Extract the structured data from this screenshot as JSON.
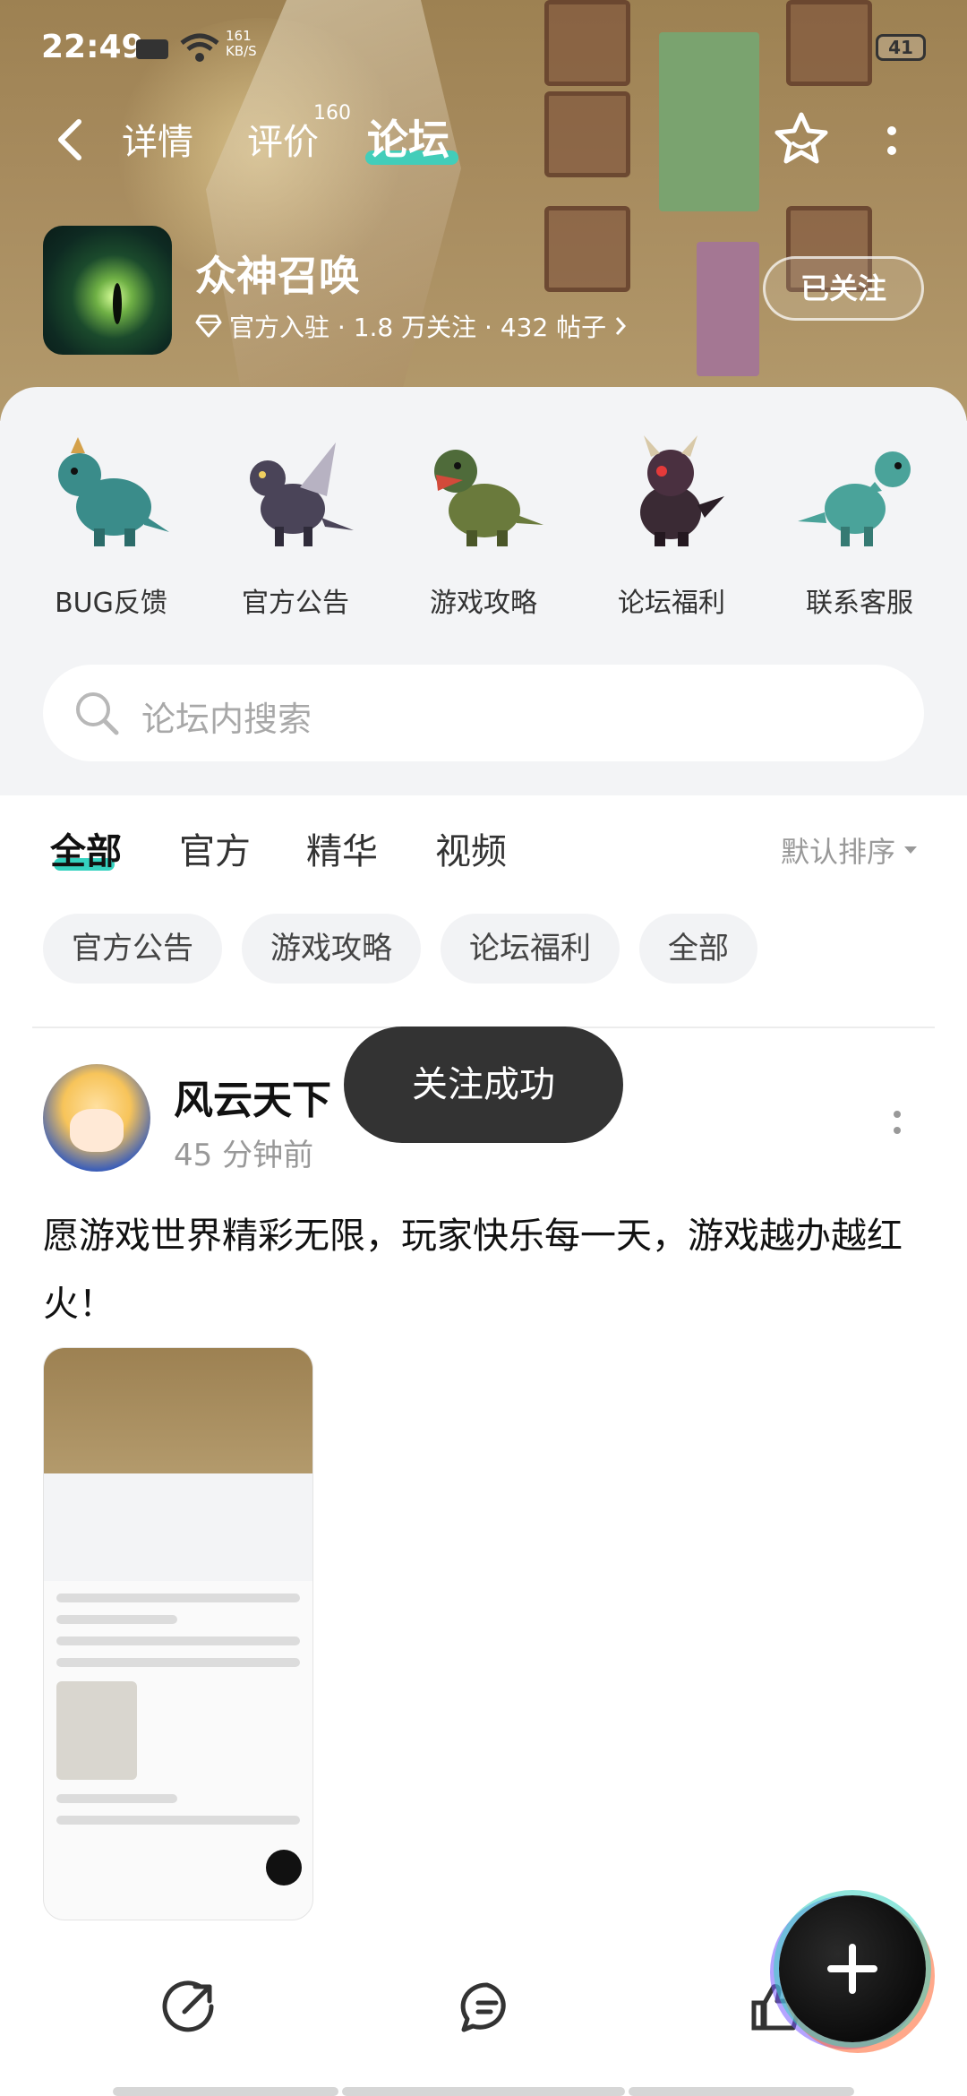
{
  "status_bar": {
    "time": "22:49",
    "speed_value": "161",
    "speed_unit": "KB/S",
    "battery": "41"
  },
  "nav": {
    "tabs": [
      {
        "label": "详情",
        "active": false
      },
      {
        "label": "评价",
        "active": false,
        "badge": "160"
      },
      {
        "label": "论坛",
        "active": true
      }
    ]
  },
  "app": {
    "name": "众神召唤",
    "meta": "官方入驻 · 1.8 万关注 · 432 帖子",
    "follow_label": "已关注"
  },
  "categories": [
    {
      "label": "BUG反馈",
      "color": "#3a8c8a"
    },
    {
      "label": "官方公告",
      "color": "#4a4458"
    },
    {
      "label": "游戏攻略",
      "color": "#6a7a3c"
    },
    {
      "label": "论坛福利",
      "color": "#3a2a34"
    },
    {
      "label": "联系客服",
      "color": "#4aa39a"
    }
  ],
  "search": {
    "placeholder": "论坛内搜索"
  },
  "filter_tabs": [
    {
      "label": "全部",
      "active": true
    },
    {
      "label": "官方",
      "active": false
    },
    {
      "label": "精华",
      "active": false
    },
    {
      "label": "视频",
      "active": false
    }
  ],
  "sort_label": "默认排序",
  "chips": [
    "官方公告",
    "游戏攻略",
    "论坛福利",
    "全部"
  ],
  "post": {
    "author": "风云天下",
    "time": "45 分钟前",
    "text": "愿游戏世界精彩无限，玩家快乐每一天，游戏越办越红火！"
  },
  "toast": "关注成功",
  "colors": {
    "accent": "#35d2c0",
    "banner": "#a88c5f",
    "panel_bg": "#f3f4f6",
    "toast_bg": "#333333"
  }
}
